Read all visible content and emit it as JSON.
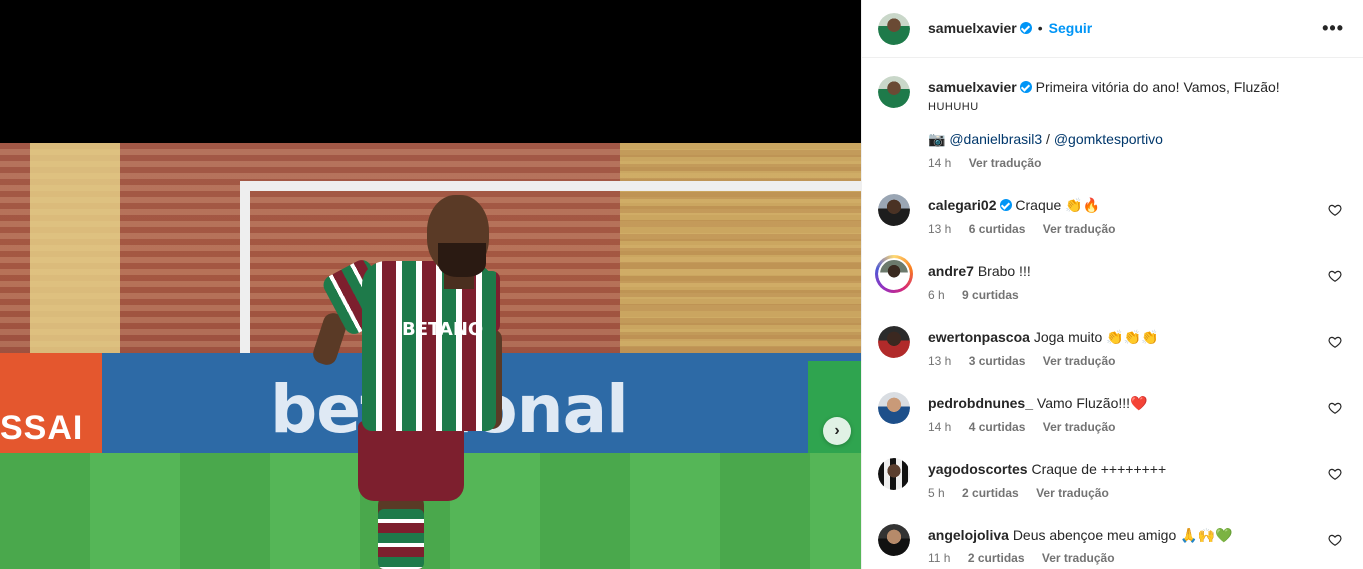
{
  "post": {
    "author": "samuelxavier",
    "follow_label": "Seguir",
    "separator": "•",
    "more_label": "•••",
    "caption_text": "Primeira vitória do ano! Vamos, Fluzão!",
    "caption_suffix": "HUHUHU",
    "credits_camera": "📷",
    "credits_user1": "@danielbrasil3",
    "credits_sep": "/",
    "credits_user2": "@gomktesportivo",
    "caption_time": "14 h",
    "translate_label": "Ver tradução"
  },
  "media": {
    "board_left_text": "SSAI",
    "board_text": "bet  cional",
    "jersey_sponsor": "BETANO",
    "next_icon": "›"
  },
  "comments": [
    {
      "user": "calegari02",
      "verified": true,
      "text": "Craque 👏🔥",
      "time": "13 h",
      "likes": "6 curtidas",
      "translate": "Ver tradução"
    },
    {
      "user": "andre7",
      "verified": false,
      "text": "Brabo !!!",
      "time": "6 h",
      "likes": "9 curtidas",
      "translate": ""
    },
    {
      "user": "ewertonpascoa",
      "verified": false,
      "text": "Joga muito 👏👏👏",
      "time": "13 h",
      "likes": "3 curtidas",
      "translate": "Ver tradução"
    },
    {
      "user": "pedrobdnunes_",
      "verified": false,
      "text": "Vamo Fluzão!!!❤️",
      "time": "14 h",
      "likes": "4 curtidas",
      "translate": "Ver tradução"
    },
    {
      "user": "yagodoscortes",
      "verified": false,
      "text": "Craque de ++++++++",
      "time": "5 h",
      "likes": "2 curtidas",
      "translate": "Ver tradução"
    },
    {
      "user": "angelojoliva",
      "verified": false,
      "text": "Deus abençoe meu amigo 🙏🙌💚",
      "time": "11 h",
      "likes": "2 curtidas",
      "translate": "Ver tradução"
    }
  ],
  "colors": {
    "accent": "#0095f6",
    "text": "#262626",
    "secondary": "#737373",
    "link": "#00376b"
  }
}
